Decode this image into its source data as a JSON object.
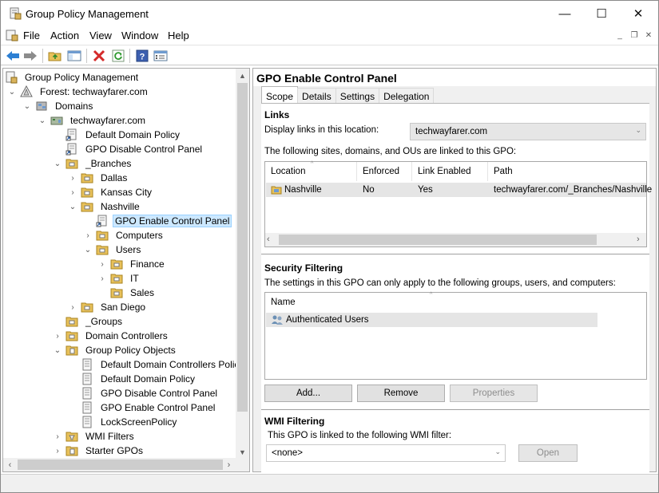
{
  "window": {
    "title": "Group Policy Management",
    "controls": {
      "minimize": "—",
      "maximize": "☐",
      "close": "✕"
    }
  },
  "menubar": {
    "items": [
      "File",
      "Action",
      "View",
      "Window",
      "Help"
    ],
    "mdi_controls": {
      "minimize": "_",
      "restore": "❐",
      "close": "✕"
    }
  },
  "toolbar": {
    "buttons": [
      "back-icon",
      "forward-icon",
      "up-folder-icon",
      "show-hide-tree-icon",
      "delete-icon",
      "refresh-icon",
      "help-icon",
      "properties-icon"
    ]
  },
  "tree": {
    "items": [
      {
        "label": "Group Policy Management",
        "expander": "",
        "icon": "gpm-icon"
      },
      {
        "label": "Forest: techwayfarer.com",
        "expander": "⌄",
        "icon": "forest-icon"
      },
      {
        "label": "Domains",
        "expander": "⌄",
        "icon": "domains-icon"
      },
      {
        "label": "techwayfarer.com",
        "expander": "⌄",
        "icon": "domain-icon"
      },
      {
        "label": "Default Domain Policy",
        "expander": "",
        "icon": "gpo-link-icon"
      },
      {
        "label": "GPO Disable Control Panel",
        "expander": "",
        "icon": "gpo-link-icon"
      },
      {
        "label": "_Branches",
        "expander": "⌄",
        "icon": "ou-icon"
      },
      {
        "label": "Dallas",
        "expander": "›",
        "icon": "ou-icon"
      },
      {
        "label": "Kansas City",
        "expander": "›",
        "icon": "ou-icon"
      },
      {
        "label": "Nashville",
        "expander": "⌄",
        "icon": "ou-icon"
      },
      {
        "label": "GPO Enable Control Panel",
        "expander": "",
        "icon": "gpo-link-icon",
        "selected": true
      },
      {
        "label": "Computers",
        "expander": "›",
        "icon": "ou-icon"
      },
      {
        "label": "Users",
        "expander": "⌄",
        "icon": "ou-icon"
      },
      {
        "label": "Finance",
        "expander": "›",
        "icon": "ou-icon"
      },
      {
        "label": "IT",
        "expander": "›",
        "icon": "ou-icon"
      },
      {
        "label": "Sales",
        "expander": "",
        "icon": "ou-icon"
      },
      {
        "label": "San Diego",
        "expander": "›",
        "icon": "ou-icon"
      },
      {
        "label": "_Groups",
        "expander": "",
        "icon": "ou-icon"
      },
      {
        "label": "Domain Controllers",
        "expander": "›",
        "icon": "ou-icon"
      },
      {
        "label": "Group Policy Objects",
        "expander": "⌄",
        "icon": "gpo-folder-icon"
      },
      {
        "label": "Default Domain Controllers Policy",
        "expander": "",
        "icon": "gpo-icon"
      },
      {
        "label": "Default Domain Policy",
        "expander": "",
        "icon": "gpo-icon"
      },
      {
        "label": "GPO Disable Control Panel",
        "expander": "",
        "icon": "gpo-icon"
      },
      {
        "label": "GPO Enable Control Panel",
        "expander": "",
        "icon": "gpo-icon"
      },
      {
        "label": "LockScreenPolicy",
        "expander": "",
        "icon": "gpo-icon"
      },
      {
        "label": "WMI Filters",
        "expander": "›",
        "icon": "wmi-folder-icon"
      },
      {
        "label": "Starter GPOs",
        "expander": "›",
        "icon": "starter-folder-icon"
      }
    ]
  },
  "details": {
    "title": "GPO Enable Control Panel",
    "tabs": [
      "Scope",
      "Details",
      "Settings",
      "Delegation"
    ],
    "active_tab": "Scope",
    "links": {
      "section_title": "Links",
      "display_label": "Display links in this location:",
      "display_value": "techwayfarer.com",
      "description": "The following sites, domains, and OUs are linked to this GPO:",
      "columns": [
        "Location",
        "Enforced",
        "Link Enabled",
        "Path"
      ],
      "rows": [
        {
          "location": "Nashville",
          "enforced": "No",
          "link_enabled": "Yes",
          "path": "techwayfarer.com/_Branches/Nashville"
        }
      ]
    },
    "security_filtering": {
      "section_title": "Security Filtering",
      "description": "The settings in this GPO can only apply to the following groups, users, and computers:",
      "columns": [
        "Name"
      ],
      "rows": [
        {
          "name": "Authenticated Users"
        }
      ],
      "buttons": {
        "add": "Add...",
        "remove": "Remove",
        "properties": "Properties"
      }
    },
    "wmi_filtering": {
      "section_title": "WMI Filtering",
      "description": "This GPO is linked to the following WMI filter:",
      "value": "<none>",
      "open_button": "Open"
    }
  }
}
